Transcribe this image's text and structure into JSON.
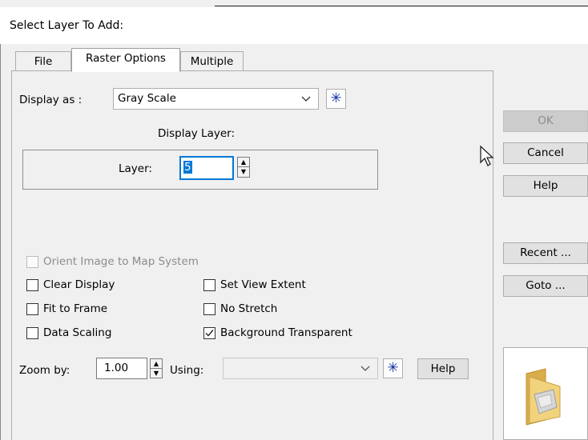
{
  "dialog": {
    "title": "Select Layer To Add:"
  },
  "tabs": [
    {
      "label": "File",
      "active": false
    },
    {
      "label": "Raster Options",
      "active": true
    },
    {
      "label": "Multiple",
      "active": false
    }
  ],
  "display_as": {
    "label": "Display as :",
    "value": "Gray Scale"
  },
  "display_layer": {
    "heading": "Display Layer:",
    "layer_label": "Layer:",
    "layer_value": "5"
  },
  "checkboxes": {
    "orient": {
      "label": "Orient Image to Map System",
      "checked": false,
      "enabled": false
    },
    "clear_display": {
      "label": "Clear Display",
      "checked": false
    },
    "fit_to_frame": {
      "label": "Fit to Frame",
      "checked": false
    },
    "data_scaling": {
      "label": "Data Scaling",
      "checked": false
    },
    "set_view_extent": {
      "label": "Set View Extent",
      "checked": false
    },
    "no_stretch": {
      "label": "No Stretch",
      "checked": false
    },
    "background_transparent": {
      "label": "Background Transparent",
      "checked": true
    }
  },
  "zoom": {
    "label": "Zoom by:",
    "value": "1.00",
    "using_label": "Using:",
    "using_value": "",
    "help_label": "Help"
  },
  "buttons": {
    "ok": "OK",
    "cancel": "Cancel",
    "help": "Help",
    "recent": "Recent ...",
    "goto": "Goto ..."
  },
  "icons": {
    "star": "asterisk-icon",
    "folder": "folder-icon",
    "cursor": "mouse-pointer-icon"
  },
  "colors": {
    "star_blue": "#0b2a9e",
    "selection_blue": "#0078d7",
    "folder_yellow": "#e8c66b"
  }
}
